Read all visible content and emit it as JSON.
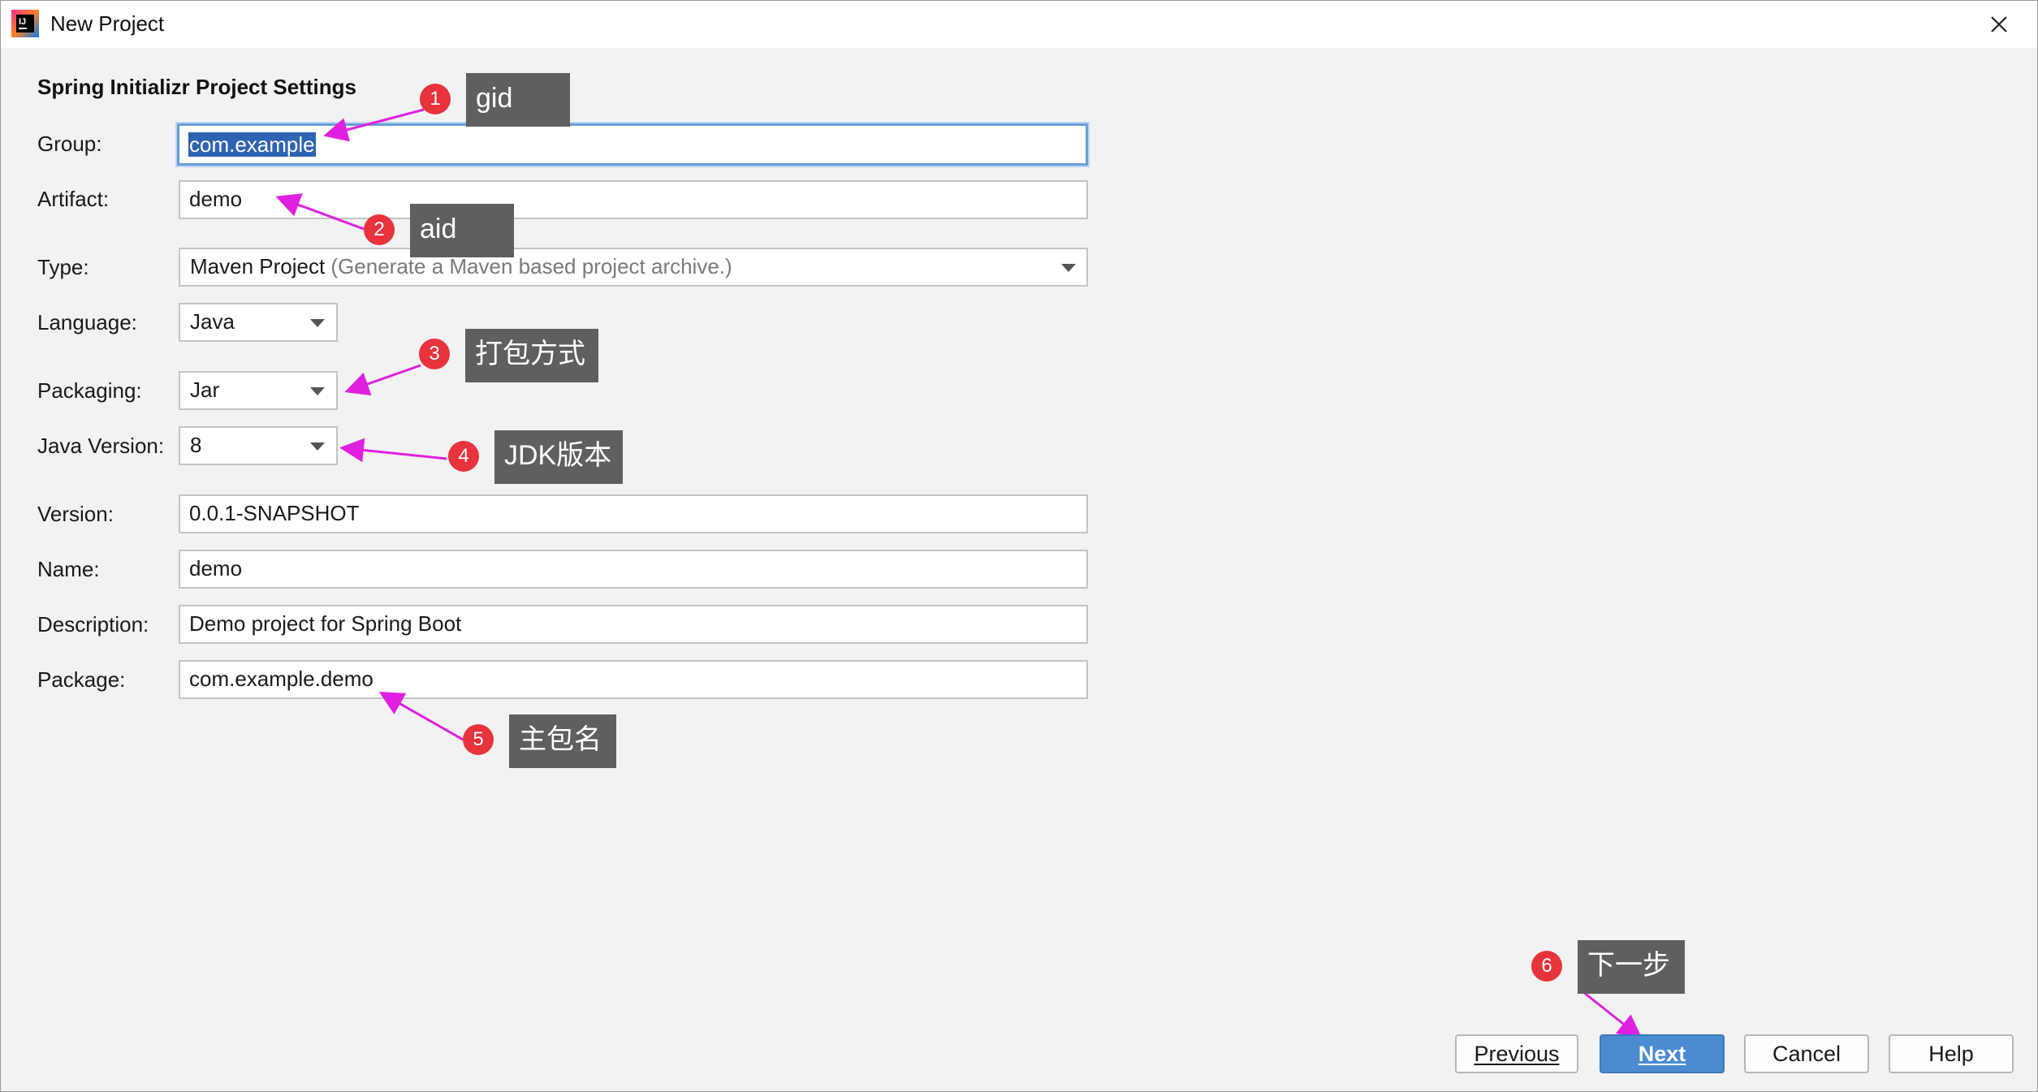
{
  "window": {
    "title": "New Project"
  },
  "section_title": "Spring Initializr Project Settings",
  "fields": {
    "group": {
      "label": "Group:",
      "value": "com.example"
    },
    "artifact": {
      "label": "Artifact:",
      "value": "demo"
    },
    "type": {
      "label": "Type:",
      "value": "Maven Project",
      "hint": "(Generate a Maven based project archive.)"
    },
    "language": {
      "label": "Language:",
      "value": "Java"
    },
    "packaging": {
      "label": "Packaging:",
      "value": "Jar"
    },
    "java_version": {
      "label": "Java Version:",
      "value": "8"
    },
    "version": {
      "label": "Version:",
      "value": "0.0.1-SNAPSHOT"
    },
    "name": {
      "label": "Name:",
      "value": "demo"
    },
    "description": {
      "label": "Description:",
      "value": "Demo project for Spring Boot"
    },
    "package": {
      "label": "Package:",
      "value": "com.example.demo"
    }
  },
  "annotations": [
    {
      "num": "1",
      "text": "gid"
    },
    {
      "num": "2",
      "text": "aid"
    },
    {
      "num": "3",
      "text": "打包方式"
    },
    {
      "num": "4",
      "text": "JDK版本"
    },
    {
      "num": "5",
      "text": "主包名"
    },
    {
      "num": "6",
      "text": "下一步"
    }
  ],
  "buttons": {
    "previous": "Previous",
    "next": "Next",
    "cancel": "Cancel",
    "help": "Help"
  },
  "colors": {
    "accent": "#4b8bd1",
    "annotation_badge": "#e8333c",
    "annotation_arrow": "#e020e0",
    "annotation_tip": "#5f5f5f"
  },
  "icons": {
    "app": "intellij-idea-icon",
    "close": "close-icon",
    "dropdown": "chevron-down-icon"
  }
}
